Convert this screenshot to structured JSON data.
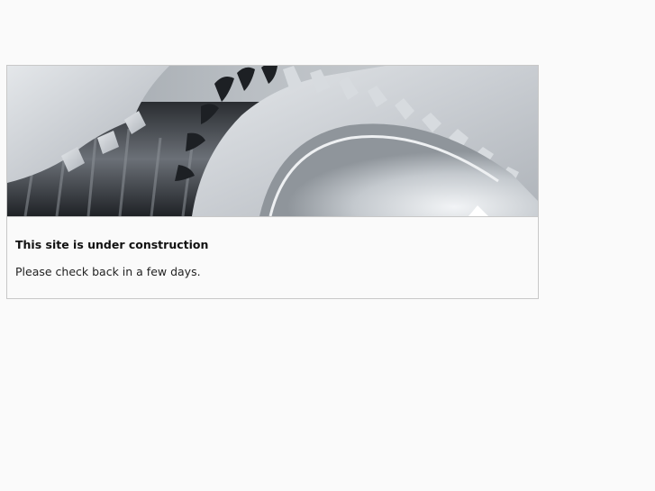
{
  "page": {
    "heading": "This site is under construction",
    "message": "Please check back in a few days."
  },
  "banner": {
    "icon": "gears-banner-image"
  }
}
